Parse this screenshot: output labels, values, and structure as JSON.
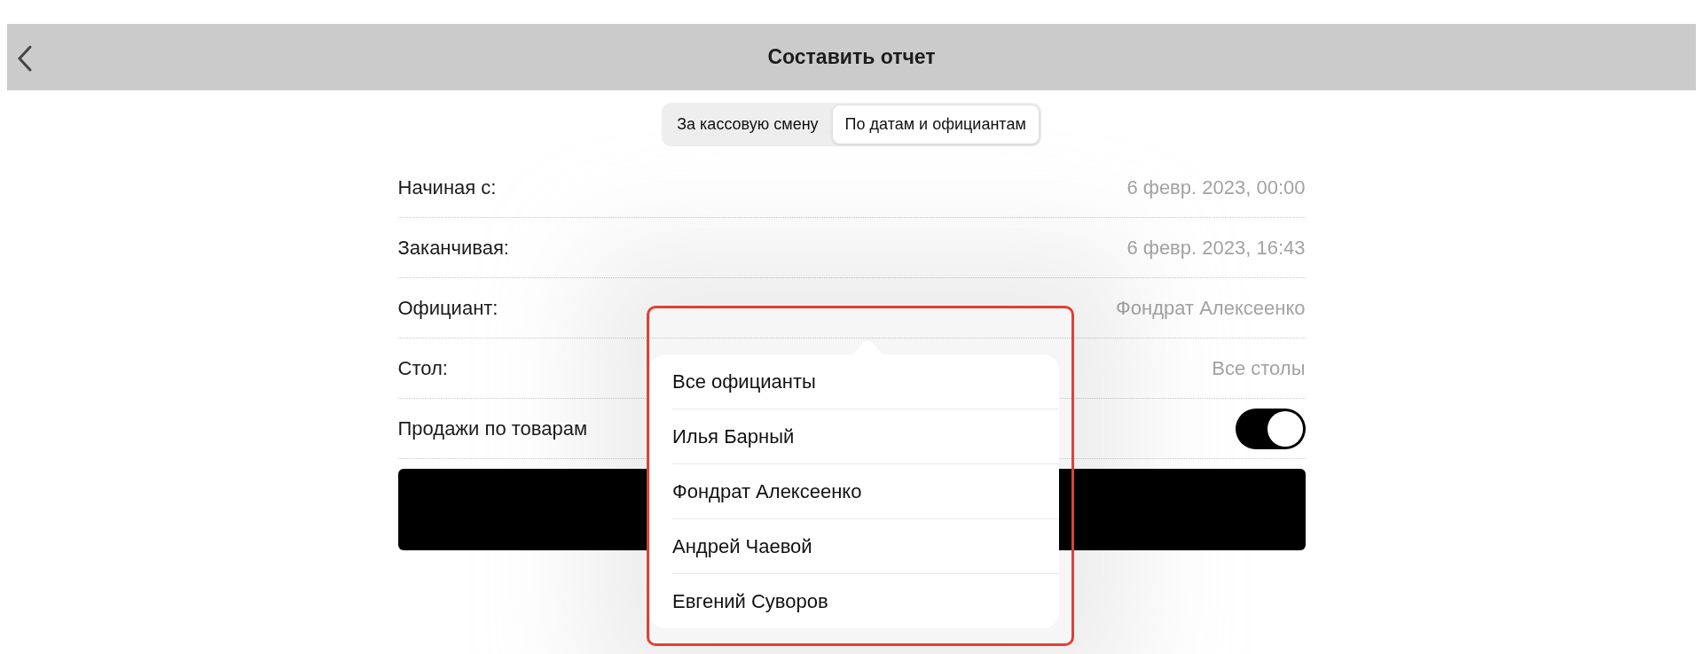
{
  "header": {
    "title": "Составить отчет"
  },
  "segments": [
    {
      "label": "За кассовую смену",
      "selected": false
    },
    {
      "label": "По датам и официантам",
      "selected": true
    }
  ],
  "fields": [
    {
      "kind": "value",
      "label": "Начиная с:",
      "value": "6 февр. 2023, 00:00"
    },
    {
      "kind": "value",
      "label": "Заканчивая:",
      "value": "6 февр. 2023, 16:43"
    },
    {
      "kind": "value",
      "label": "Официант:",
      "value": "Фондрат Алексеенко"
    },
    {
      "kind": "value",
      "label": "Стол:",
      "value": "Все столы"
    },
    {
      "kind": "toggle",
      "label": "Продажи по товарам",
      "on": true
    }
  ],
  "popover": {
    "items": [
      {
        "label": "Все официанты"
      },
      {
        "label": "Илья Барный"
      },
      {
        "label": "Фондрат Алексеенко"
      },
      {
        "label": "Андрей Чаевой"
      },
      {
        "label": "Евгений Суворов"
      }
    ]
  }
}
